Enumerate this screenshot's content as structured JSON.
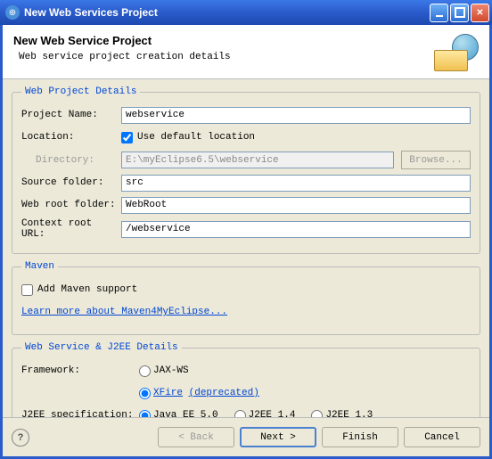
{
  "window": {
    "title": "New Web Services Project"
  },
  "banner": {
    "title": "New Web Service Project",
    "subtitle": "Web service project creation details"
  },
  "details": {
    "legend": "Web Project Details",
    "project_name_label": "Project Name:",
    "project_name": "webservice",
    "location_label": "Location:",
    "use_default_label": "Use default location",
    "use_default_checked": true,
    "directory_label": "Directory:",
    "directory": "E:\\myEclipse6.5\\webservice",
    "browse_label": "Browse...",
    "source_folder_label": "Source folder:",
    "source_folder": "src",
    "web_root_label": "Web root folder:",
    "web_root": "WebRoot",
    "context_root_label": "Context root URL:",
    "context_root": "/webservice"
  },
  "maven": {
    "legend": "Maven",
    "add_support_label": "Add Maven support",
    "add_support_checked": false,
    "learn_more": "Learn more about Maven4MyEclipse..."
  },
  "ws": {
    "legend": "Web Service & J2EE Details",
    "framework_label": "Framework:",
    "framework_options": {
      "jaxws": "JAX-WS",
      "xfire": "XFire",
      "xfire_depr": "(deprecated)"
    },
    "framework_selected": "xfire",
    "j2ee_label": "J2EE specification:",
    "j2ee_options": {
      "ee5": "Java EE 5.0",
      "j2ee14": "J2EE 1.4",
      "j2ee13": "J2EE 1.3"
    },
    "j2ee_selected": "ee5"
  },
  "buttons": {
    "back": "< Back",
    "next": "Next >",
    "finish": "Finish",
    "cancel": "Cancel"
  }
}
